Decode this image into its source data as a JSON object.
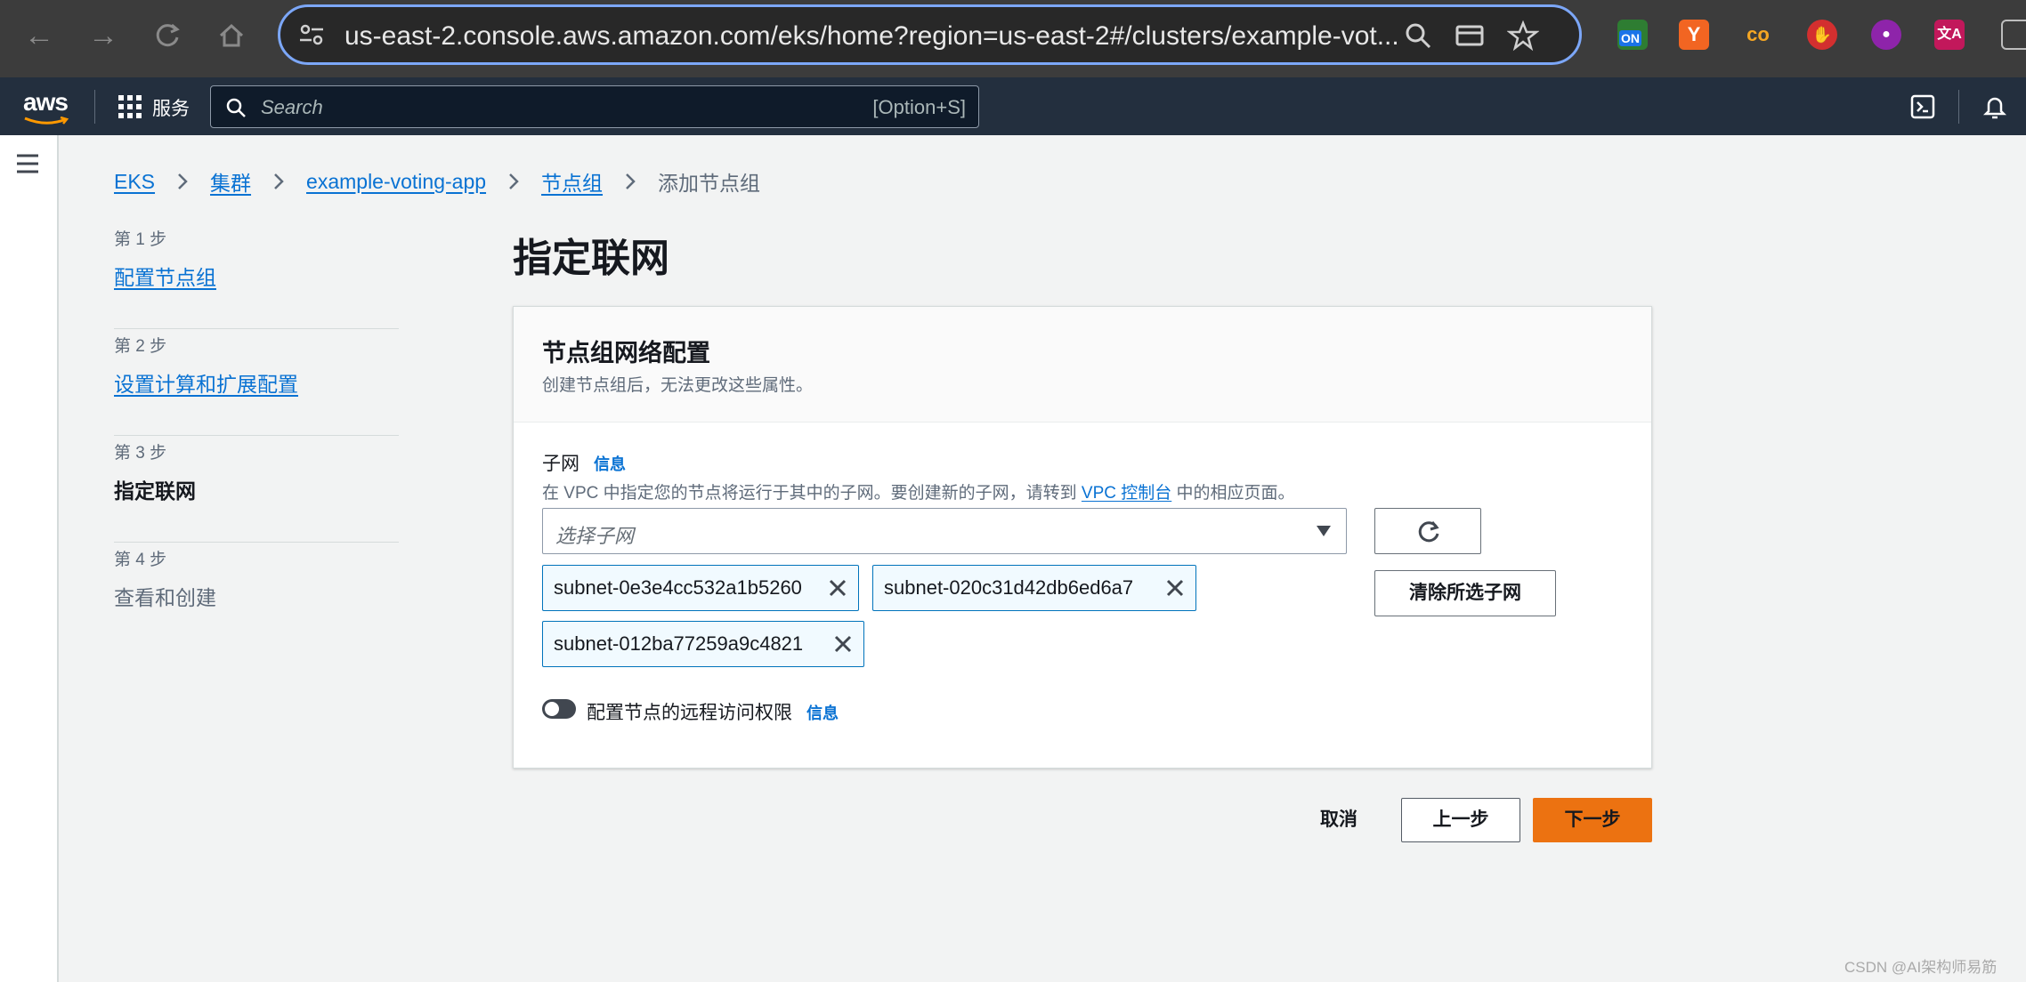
{
  "browser": {
    "url": "us-east-2.console.aws.amazon.com/eks/home?region=us-east-2#/clusters/example-vot...",
    "extensions": [
      {
        "name": "on-extension-icon",
        "text": "ON",
        "color": "#2e7d32"
      },
      {
        "name": "y-extension-icon",
        "text": "Y",
        "color": "#f26522"
      },
      {
        "name": "co-extension-icon",
        "text": "co",
        "color": "#3c3c3c"
      },
      {
        "name": "stop-hand-extension-icon",
        "text": "✋",
        "color": "#d32f2f"
      },
      {
        "name": "brain-extension-icon",
        "text": "🧠",
        "color": "#3c3c3c"
      },
      {
        "name": "translate-extension-icon",
        "text": "文A",
        "color": "#c2185b"
      }
    ]
  },
  "awsnav": {
    "logo": "aws",
    "services_label": "服务",
    "search_placeholder": "Search",
    "search_shortcut": "[Option+S]"
  },
  "breadcrumbs": {
    "items": [
      "EKS",
      "集群",
      "example-voting-app",
      "节点组"
    ],
    "current": "添加节点组"
  },
  "steps": [
    {
      "num": "第 1 步",
      "label": "配置节点组",
      "state": "link"
    },
    {
      "num": "第 2 步",
      "label": "设置计算和扩展配置",
      "state": "link"
    },
    {
      "num": "第 3 步",
      "label": "指定联网",
      "state": "current"
    },
    {
      "num": "第 4 步",
      "label": "查看和创建",
      "state": "disabled"
    }
  ],
  "page_title": "指定联网",
  "panel": {
    "title": "节点组网络配置",
    "description": "创建节点组后，无法更改这些属性。",
    "subnet_label": "子网",
    "info": "信息",
    "subnet_desc_before": "在 VPC 中指定您的节点将运行于其中的子网。要创建新的子网，请转到 ",
    "subnet_desc_link": "VPC 控制台",
    "subnet_desc_after": " 中的相应页面。",
    "select_placeholder": "选择子网",
    "clear_button": "清除所选子网",
    "tokens": [
      "subnet-0e3e4cc532a1b5260",
      "subnet-020c31d42db6ed6a7",
      "subnet-012ba77259a9c4821"
    ],
    "toggle_label": "配置节点的远程访问权限",
    "toggle_on": false
  },
  "footer": {
    "cancel": "取消",
    "previous": "上一步",
    "next": "下一步"
  },
  "watermark": "CSDN @AI架构师易筋",
  "colors": {
    "link": "#0972d3",
    "primary_button": "#ec7211",
    "nav_bg": "#232f3e"
  }
}
